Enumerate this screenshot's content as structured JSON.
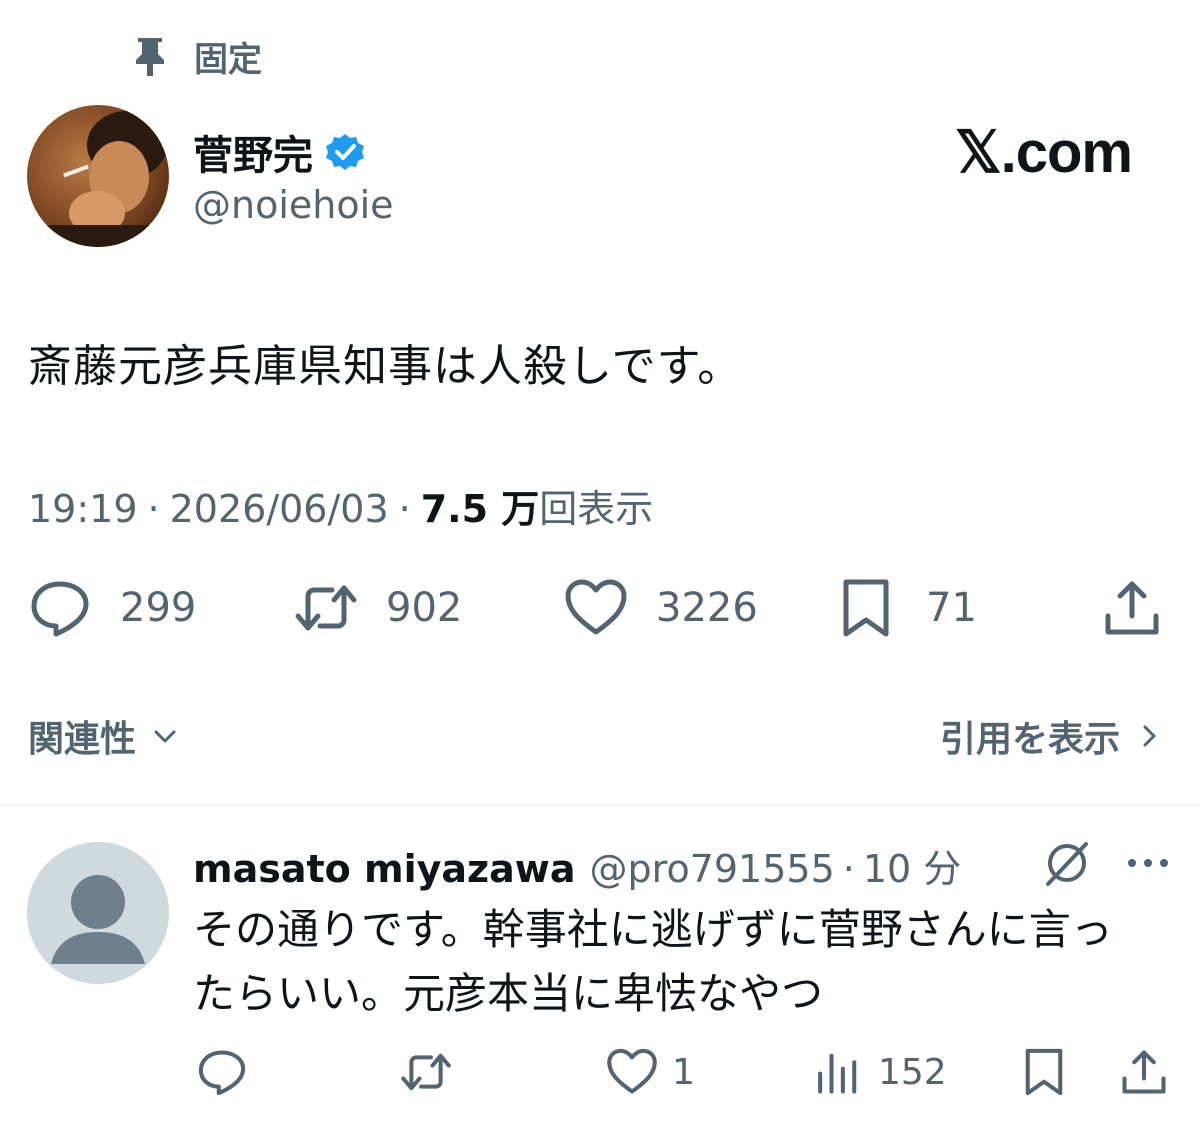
{
  "pinned": {
    "label": "固定",
    "icon": "pin-icon"
  },
  "tweet": {
    "author_name": "菅野完",
    "author_handle": "@noiehoie",
    "verified": true,
    "text": "斎藤元彦兵庫県知事は人殺しです。",
    "time": "19:19",
    "separator": "·",
    "date": "2026/06/03",
    "views_number": "7.5 万",
    "views_label": "回表示",
    "actions": {
      "replies": "299",
      "retweets": "902",
      "likes": "3226",
      "bookmarks": "71"
    }
  },
  "brand": {
    "label": "𝕏.com"
  },
  "filters": {
    "relevance_label": "関連性",
    "quotes_label": "引用を表示"
  },
  "reply": {
    "name": "masato miyazawa",
    "handle": "@pro791555",
    "separator": "·",
    "time": "10 分",
    "text": "その通りです。幹事社に逃げずに菅野さんに言ったらいい。元彦本当に卑怯なやつ",
    "actions": {
      "replies": "",
      "retweets": "",
      "likes": "1",
      "views": "152"
    }
  },
  "colors": {
    "text_primary": "#0f1419",
    "text_secondary": "#536471",
    "verified_blue": "#1d9bf0",
    "divider": "#eff3f4",
    "default_avatar_bg": "#cfd9de"
  }
}
